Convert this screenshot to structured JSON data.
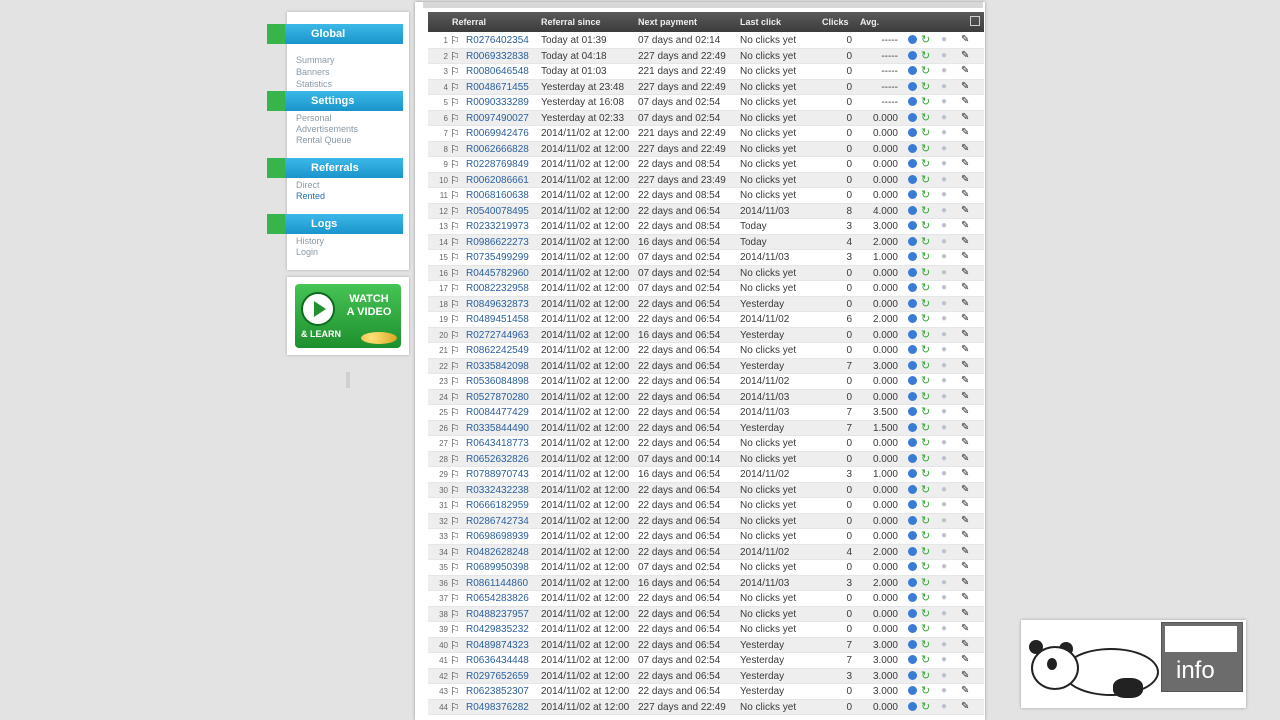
{
  "nav": {
    "sections": [
      {
        "title": "Global",
        "links": [
          "Summary",
          "Banners",
          "Statistics"
        ],
        "active": -1
      },
      {
        "title": "Settings",
        "links": [
          "Personal",
          "Advertisements",
          "Rental Queue"
        ],
        "active": -1
      },
      {
        "title": "Referrals",
        "links": [
          "Direct",
          "Rented"
        ],
        "active": 1
      },
      {
        "title": "Logs",
        "links": [
          "History",
          "Login"
        ],
        "active": -1
      }
    ],
    "video": {
      "title_line1": "WATCH",
      "title_line2": "A VIDEO",
      "sub": "& LEARN"
    }
  },
  "table": {
    "headers": [
      "Referral",
      "Referral since",
      "Next payment",
      "Last click",
      "Clicks",
      "Avg."
    ],
    "rows": [
      [
        "1",
        "R0276402354",
        "Today at 01:39",
        "07 days and 02:14",
        "No clicks yet",
        "0",
        "-----"
      ],
      [
        "2",
        "R0069332838",
        "Today at 04:18",
        "227 days and 22:49",
        "No clicks yet",
        "0",
        "-----"
      ],
      [
        "3",
        "R0080646548",
        "Today at 01:03",
        "221 days and 22:49",
        "No clicks yet",
        "0",
        "-----"
      ],
      [
        "4",
        "R0048671455",
        "Yesterday at 23:48",
        "227 days and 22:49",
        "No clicks yet",
        "0",
        "-----"
      ],
      [
        "5",
        "R0090333289",
        "Yesterday at 16:08",
        "07 days and 02:54",
        "No clicks yet",
        "0",
        "-----"
      ],
      [
        "6",
        "R0097490027",
        "Yesterday at 02:33",
        "07 days and 02:54",
        "No clicks yet",
        "0",
        "0.000"
      ],
      [
        "7",
        "R0069942476",
        "2014/11/02 at 12:00",
        "221 days and 22:49",
        "No clicks yet",
        "0",
        "0.000"
      ],
      [
        "8",
        "R0062666828",
        "2014/11/02 at 12:00",
        "227 days and 22:49",
        "No clicks yet",
        "0",
        "0.000"
      ],
      [
        "9",
        "R0228769849",
        "2014/11/02 at 12:00",
        "22 days and 08:54",
        "No clicks yet",
        "0",
        "0.000"
      ],
      [
        "10",
        "R0062086661",
        "2014/11/02 at 12:00",
        "227 days and 23:49",
        "No clicks yet",
        "0",
        "0.000"
      ],
      [
        "11",
        "R0068160638",
        "2014/11/02 at 12:00",
        "22 days and 08:54",
        "No clicks yet",
        "0",
        "0.000"
      ],
      [
        "12",
        "R0540078495",
        "2014/11/02 at 12:00",
        "22 days and 06:54",
        "2014/11/03",
        "8",
        "4.000"
      ],
      [
        "13",
        "R0233219973",
        "2014/11/02 at 12:00",
        "22 days and 08:54",
        "Today",
        "3",
        "3.000"
      ],
      [
        "14",
        "R0986622273",
        "2014/11/02 at 12:00",
        "16 days and 06:54",
        "Today",
        "4",
        "2.000"
      ],
      [
        "15",
        "R0735499299",
        "2014/11/02 at 12:00",
        "07 days and 02:54",
        "2014/11/03",
        "3",
        "1.000"
      ],
      [
        "16",
        "R0445782960",
        "2014/11/02 at 12:00",
        "07 days and 02:54",
        "No clicks yet",
        "0",
        "0.000"
      ],
      [
        "17",
        "R0082232958",
        "2014/11/02 at 12:00",
        "07 days and 02:54",
        "No clicks yet",
        "0",
        "0.000"
      ],
      [
        "18",
        "R0849632873",
        "2014/11/02 at 12:00",
        "22 days and 06:54",
        "Yesterday",
        "0",
        "0.000"
      ],
      [
        "19",
        "R0489451458",
        "2014/11/02 at 12:00",
        "22 days and 06:54",
        "2014/11/02",
        "6",
        "2.000"
      ],
      [
        "20",
        "R0272744963",
        "2014/11/02 at 12:00",
        "16 days and 06:54",
        "Yesterday",
        "0",
        "0.000"
      ],
      [
        "21",
        "R0862242549",
        "2014/11/02 at 12:00",
        "22 days and 06:54",
        "No clicks yet",
        "0",
        "0.000"
      ],
      [
        "22",
        "R0335842098",
        "2014/11/02 at 12:00",
        "22 days and 06:54",
        "Yesterday",
        "7",
        "3.000"
      ],
      [
        "23",
        "R0536084898",
        "2014/11/02 at 12:00",
        "22 days and 06:54",
        "2014/11/02",
        "0",
        "0.000"
      ],
      [
        "24",
        "R0527870280",
        "2014/11/02 at 12:00",
        "22 days and 06:54",
        "2014/11/03",
        "0",
        "0.000"
      ],
      [
        "25",
        "R0084477429",
        "2014/11/02 at 12:00",
        "22 days and 06:54",
        "2014/11/03",
        "7",
        "3.500"
      ],
      [
        "26",
        "R0335844490",
        "2014/11/02 at 12:00",
        "22 days and 06:54",
        "Yesterday",
        "7",
        "1.500"
      ],
      [
        "27",
        "R0643418773",
        "2014/11/02 at 12:00",
        "22 days and 06:54",
        "No clicks yet",
        "0",
        "0.000"
      ],
      [
        "28",
        "R0652632826",
        "2014/11/02 at 12:00",
        "07 days and 00:14",
        "No clicks yet",
        "0",
        "0.000"
      ],
      [
        "29",
        "R0788970743",
        "2014/11/02 at 12:00",
        "16 days and 06:54",
        "2014/11/02",
        "3",
        "1.000"
      ],
      [
        "30",
        "R0332432238",
        "2014/11/02 at 12:00",
        "22 days and 06:54",
        "No clicks yet",
        "0",
        "0.000"
      ],
      [
        "31",
        "R0666182959",
        "2014/11/02 at 12:00",
        "22 days and 06:54",
        "No clicks yet",
        "0",
        "0.000"
      ],
      [
        "32",
        "R0286742734",
        "2014/11/02 at 12:00",
        "22 days and 06:54",
        "No clicks yet",
        "0",
        "0.000"
      ],
      [
        "33",
        "R0698698939",
        "2014/11/02 at 12:00",
        "22 days and 06:54",
        "No clicks yet",
        "0",
        "0.000"
      ],
      [
        "34",
        "R0482628248",
        "2014/11/02 at 12:00",
        "22 days and 06:54",
        "2014/11/02",
        "4",
        "2.000"
      ],
      [
        "35",
        "R0689950398",
        "2014/11/02 at 12:00",
        "07 days and 02:54",
        "No clicks yet",
        "0",
        "0.000"
      ],
      [
        "36",
        "R0861144860",
        "2014/11/02 at 12:00",
        "16 days and 06:54",
        "2014/11/03",
        "3",
        "2.000"
      ],
      [
        "37",
        "R0654283826",
        "2014/11/02 at 12:00",
        "22 days and 06:54",
        "No clicks yet",
        "0",
        "0.000"
      ],
      [
        "38",
        "R0488237957",
        "2014/11/02 at 12:00",
        "22 days and 06:54",
        "No clicks yet",
        "0",
        "0.000"
      ],
      [
        "39",
        "R0429835232",
        "2014/11/02 at 12:00",
        "22 days and 06:54",
        "No clicks yet",
        "0",
        "0.000"
      ],
      [
        "40",
        "R0489874323",
        "2014/11/02 at 12:00",
        "22 days and 06:54",
        "Yesterday",
        "7",
        "3.000"
      ],
      [
        "41",
        "R0636434448",
        "2014/11/02 at 12:00",
        "07 days and 02:54",
        "Yesterday",
        "7",
        "3.000"
      ],
      [
        "42",
        "R0297652659",
        "2014/11/02 at 12:00",
        "22 days and 06:54",
        "Yesterday",
        "3",
        "3.000"
      ],
      [
        "43",
        "R0623852307",
        "2014/11/02 at 12:00",
        "22 days and 06:54",
        "Yesterday",
        "0",
        "3.000"
      ],
      [
        "44",
        "R0498376282",
        "2014/11/02 at 12:00",
        "227 days and 22:49",
        "No clicks yet",
        "0",
        "0.000"
      ]
    ]
  },
  "overlay": {
    "label": "info"
  },
  "colors": {
    "nav_header": "#1a95cc",
    "nav_ribbon": "#37b54a",
    "table_header": "#4a4a4a",
    "ref_link": "#2a5f9e"
  },
  "icons": {
    "flag": "flag-icon",
    "status": "globe-icon",
    "arrow": "refresh-arrow-icon",
    "user": "user-icon",
    "edit": "pencil-icon"
  }
}
